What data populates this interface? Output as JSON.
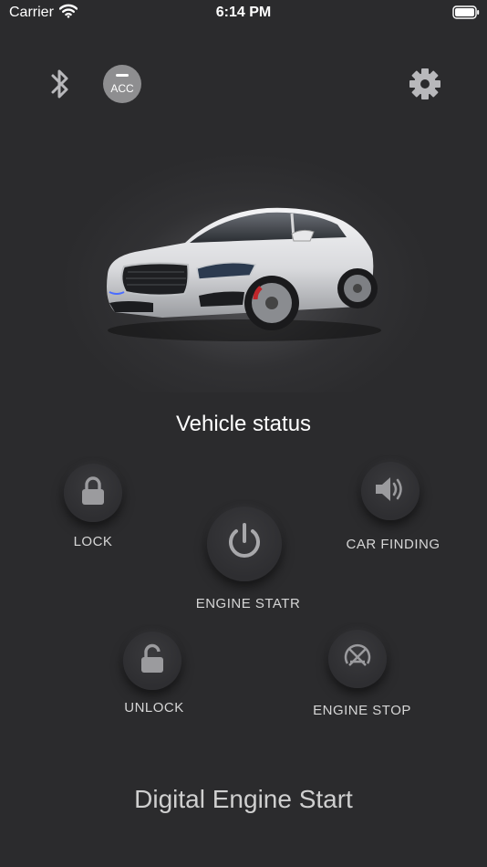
{
  "status_bar": {
    "carrier": "Carrier",
    "time": "6:14 PM"
  },
  "top_bar": {
    "acc_label": "ACC",
    "icons": [
      "bluetooth-icon",
      "acc-icon",
      "gear-icon"
    ]
  },
  "vehicle": {
    "status_title": "Vehicle status"
  },
  "controls": {
    "lock": "LOCK",
    "car_finding": "CAR FINDING",
    "engine_start": "ENGINE STATR",
    "unlock": "UNLOCK",
    "engine_stop": "ENGINE STOP"
  },
  "footer": {
    "title": "Digital Engine Start"
  },
  "colors": {
    "background": "#2b2b2d",
    "icon_gray": "#b8b8bb",
    "acc_badge": "#8e8e90"
  }
}
